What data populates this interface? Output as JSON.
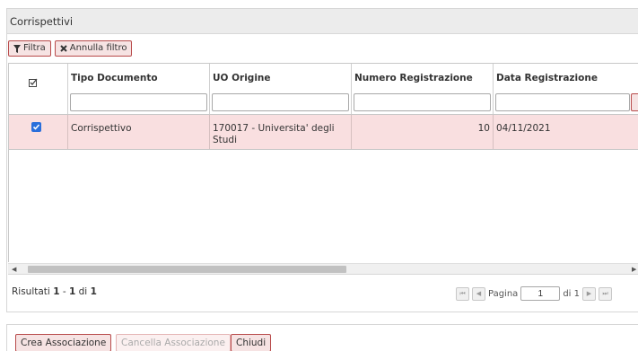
{
  "panel": {
    "title": "Corrispettivi"
  },
  "toolbar": {
    "filter_label": "Filtra",
    "clear_filter_label": "Annulla filtro"
  },
  "table": {
    "columns": [
      "Tipo Documento",
      "UO Origine",
      "Numero Registrazione",
      "Data Registrazione"
    ],
    "rows": [
      {
        "checked": true,
        "tipo_documento": "Corrispettivo",
        "uo_origine": "170017 - Universita' degli Studi",
        "numero_registrazione": "10",
        "data_registrazione": "04/11/2021"
      }
    ]
  },
  "results": {
    "prefix": "Risultati",
    "from": "1",
    "sep": "-",
    "to": "1",
    "of_label": "di",
    "total": "1"
  },
  "pager": {
    "page_label": "Pagina",
    "page_value": "1",
    "of_pages": "di 1"
  },
  "actions": {
    "create_label": "Crea Associazione",
    "cancel_label": "Cancella Associazione",
    "close_label": "Chiudi"
  },
  "colors": {
    "accent_border": "#b84a4a",
    "button_bg": "#f6e3e3",
    "selected_row_bg": "#f9dfe0",
    "checkbox": "#2a6fdb"
  }
}
